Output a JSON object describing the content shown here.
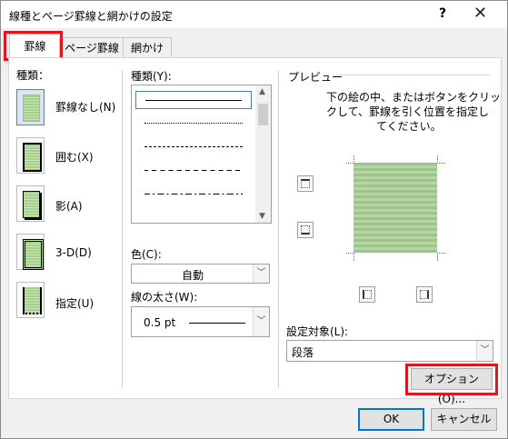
{
  "window": {
    "title": "線種とページ罫線と網かけの設定",
    "help": "?",
    "close": "✕"
  },
  "tabs": [
    {
      "label": "罫線",
      "active": true
    },
    {
      "label": "ページ罫線",
      "active": false
    },
    {
      "label": "網かけ",
      "active": false
    }
  ],
  "setting": {
    "heading": "種類：",
    "items": [
      {
        "label": "罫線なし(N)"
      },
      {
        "label": "囲む(X)"
      },
      {
        "label": "影(A)"
      },
      {
        "label": "3-D(D)"
      },
      {
        "label": "指定(U)"
      }
    ]
  },
  "style": {
    "heading": "種類(Y):"
  },
  "color": {
    "label": "色(C):",
    "value": "自動"
  },
  "width": {
    "label": "線の太さ(W):",
    "value": "0.5 pt"
  },
  "preview": {
    "heading": "プレビュー",
    "instructions": [
      "下の絵の中、またはボタンをクリッ",
      "クして、罫線を引く位置を指定し",
      "てください。"
    ]
  },
  "apply_to": {
    "label": "設定対象(L):",
    "value": "段落"
  },
  "buttons": {
    "options": "オプション(O)...",
    "ok": "OK",
    "cancel": "キャンセル"
  },
  "colors": {
    "highlight": "#e8141c",
    "accent": "#0078d7"
  }
}
